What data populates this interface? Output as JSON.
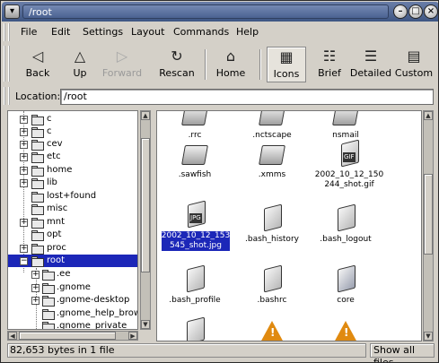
{
  "window": {
    "title": "/root"
  },
  "menubar": {
    "items": [
      "File",
      "Edit",
      "Settings",
      "Layout",
      "Commands",
      "Help"
    ]
  },
  "toolbar": {
    "back": "Back",
    "up": "Up",
    "forward": "Forward",
    "rescan": "Rescan",
    "home": "Home",
    "icons": "Icons",
    "brief": "Brief",
    "detailed": "Detailed",
    "custom": "Custom"
  },
  "location": {
    "label": "Location:",
    "value": "/root"
  },
  "tree": {
    "items": [
      "c",
      "c",
      "cev",
      "etc",
      "home",
      "lib",
      "lost+found",
      "misc",
      "mnt",
      "opt",
      "proc",
      "root",
      ".ee",
      ".gnome",
      ".gnome-desktop",
      ".gnome_help_brow",
      ".gnome_private"
    ],
    "selected": "root"
  },
  "files": [
    {
      "name": ".rrc",
      "type": "folder"
    },
    {
      "name": ".nctscape",
      "type": "folder"
    },
    {
      "name": "nsmail",
      "type": "folder"
    },
    {
      "name": ".sawfish",
      "type": "folder"
    },
    {
      "name": ".xmms",
      "type": "folder"
    },
    {
      "name": "2002_10_12_150\n244_shot.gif",
      "type": "image"
    },
    {
      "name": "2002_10_12_153\n545_shot.jpg",
      "type": "image",
      "selected": true
    },
    {
      "name": ".bash_history",
      "type": "doc"
    },
    {
      "name": ".bash_logout",
      "type": "doc"
    },
    {
      "name": ".bash_profile",
      "type": "doc"
    },
    {
      "name": ".bashrc",
      "type": "doc"
    },
    {
      "name": "core",
      "type": "core"
    },
    {
      "name": "",
      "type": "doc"
    },
    {
      "name": "",
      "type": "warning"
    },
    {
      "name": "",
      "type": "warning"
    }
  ],
  "status": {
    "text": "82,653 bytes in 1 file",
    "filter": "Show all files"
  },
  "colors": {
    "selection": "#1c27b8",
    "warning": "#e08a10"
  }
}
